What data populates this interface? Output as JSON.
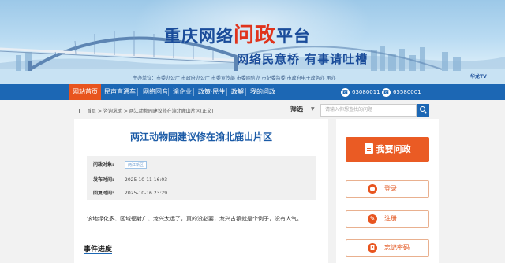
{
  "banner": {
    "title_prefix": "重庆网络",
    "title_highlight": "问政",
    "title_suffix": "平台",
    "slogan": "网络民意桥   有事请吐槽",
    "organizers": "主办单位：市委办公厅  市政府办公厅  市委宣传部  市委网信办  市纪委监委  市政府电子政务办  承办",
    "tv_logo": "华龙TV"
  },
  "nav": {
    "items": [
      "网站首页",
      "民声直通车",
      "网络回音",
      "渝企业",
      "政策·民生",
      "政解",
      "我的问政"
    ],
    "phone1": "63080011",
    "phone2": "65580001"
  },
  "breadcrumb": {
    "home_label": "首页",
    "separator": ">",
    "section": "咨询求助",
    "current": "两江动物园建议修在渝北鹿山片区(正文)"
  },
  "search": {
    "filter_label": "筛选",
    "placeholder": "请输入你想查找的问题"
  },
  "article": {
    "title": "两江动物园建议修在渝北鹿山片区",
    "meta": {
      "target_label": "问政对象:",
      "target_value": "两江新区",
      "published_label": "发布时间:",
      "published_value": "2025-10-11 16:03",
      "replied_label": "回复时间:",
      "replied_value": "2025-10-16 23:29"
    },
    "content": "该地绿化多、区域辐射广、龙兴太远了，真的没必要，龙兴古镇就是个例子，没有人气。",
    "progress_title": "事件进度"
  },
  "sidebar": {
    "ask_label": "我要问政",
    "login_label": "登录",
    "register_label": "注册",
    "forgot_label": "忘记密码"
  }
}
